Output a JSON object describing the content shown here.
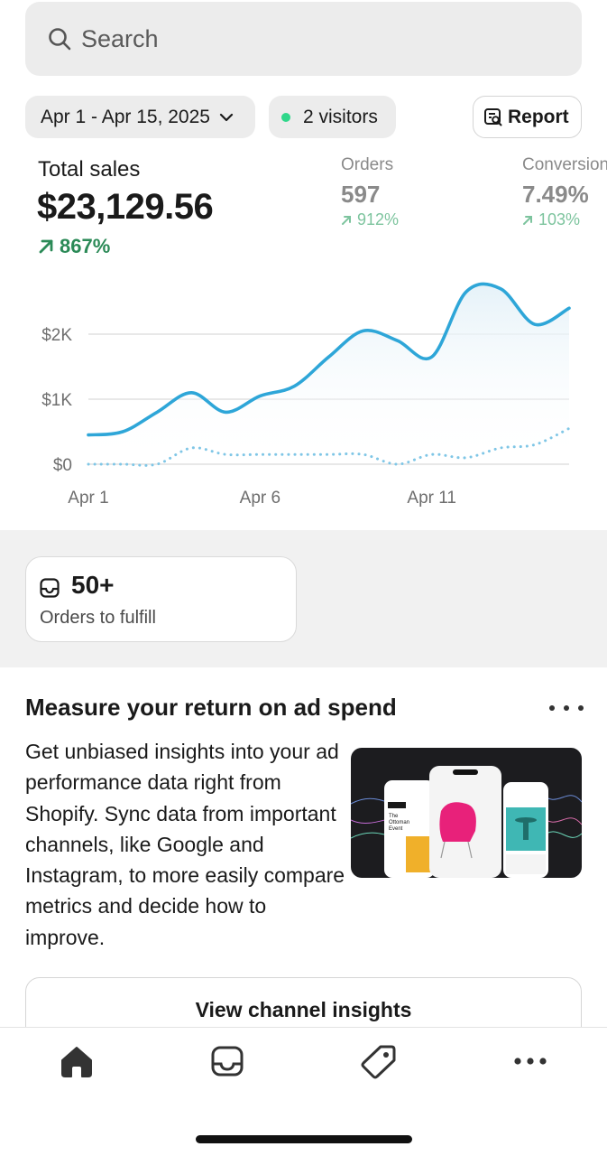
{
  "search": {
    "placeholder": "Search",
    "icon": "search-icon"
  },
  "filters": {
    "date_range": "Apr 1 - Apr 15, 2025",
    "visitors": "2 visitors",
    "report_label": "Report"
  },
  "metrics": {
    "total_sales": {
      "label": "Total sales",
      "value": "$23,129.56",
      "change": "867%"
    },
    "orders": {
      "label": "Orders",
      "value": "597",
      "change": "912%"
    },
    "conversion": {
      "label": "Conversion rate",
      "value": "7.49%",
      "change": "103%"
    }
  },
  "chart_data": {
    "type": "line",
    "x": [
      "Apr 1",
      "Apr 2",
      "Apr 3",
      "Apr 4",
      "Apr 5",
      "Apr 6",
      "Apr 7",
      "Apr 8",
      "Apr 9",
      "Apr 10",
      "Apr 11",
      "Apr 12",
      "Apr 13",
      "Apr 14",
      "Apr 15"
    ],
    "x_tick_labels": [
      "Apr 1",
      "Apr 6",
      "Apr 11"
    ],
    "y_tick_labels": [
      "$0",
      "$1K",
      "$2K"
    ],
    "ylim": [
      0,
      2800
    ],
    "series": [
      {
        "values": [
          450,
          500,
          800,
          1100,
          800,
          1050,
          1200,
          1650,
          2050,
          1900,
          1650,
          2650,
          2700,
          2150,
          2400
        ],
        "color": "#2ea6d8",
        "style": "solid"
      },
      {
        "values": [
          0,
          0,
          0,
          250,
          150,
          150,
          150,
          150,
          150,
          0,
          150,
          100,
          250,
          300,
          550
        ],
        "color": "#7fc6e6",
        "style": "dotted"
      }
    ],
    "grid": true
  },
  "fulfill": {
    "count": "50+",
    "label": "Orders to fulfill"
  },
  "promo": {
    "title": "Measure your return on ad spend",
    "body": "Get unbiased insights into your ad performance data right from Shopify. Sync data from important channels, like Google and Instagram, to more easily compare metrics and decide how to improve.",
    "image_text": "The Ottoman Event",
    "cta": "View channel insights"
  },
  "tabs": [
    "home-icon",
    "orders-icon",
    "products-icon",
    "more-icon"
  ],
  "colors": {
    "accent_line": "#2ea6d8",
    "positive": "#2b8a57",
    "live_dot": "#2fd78a"
  }
}
